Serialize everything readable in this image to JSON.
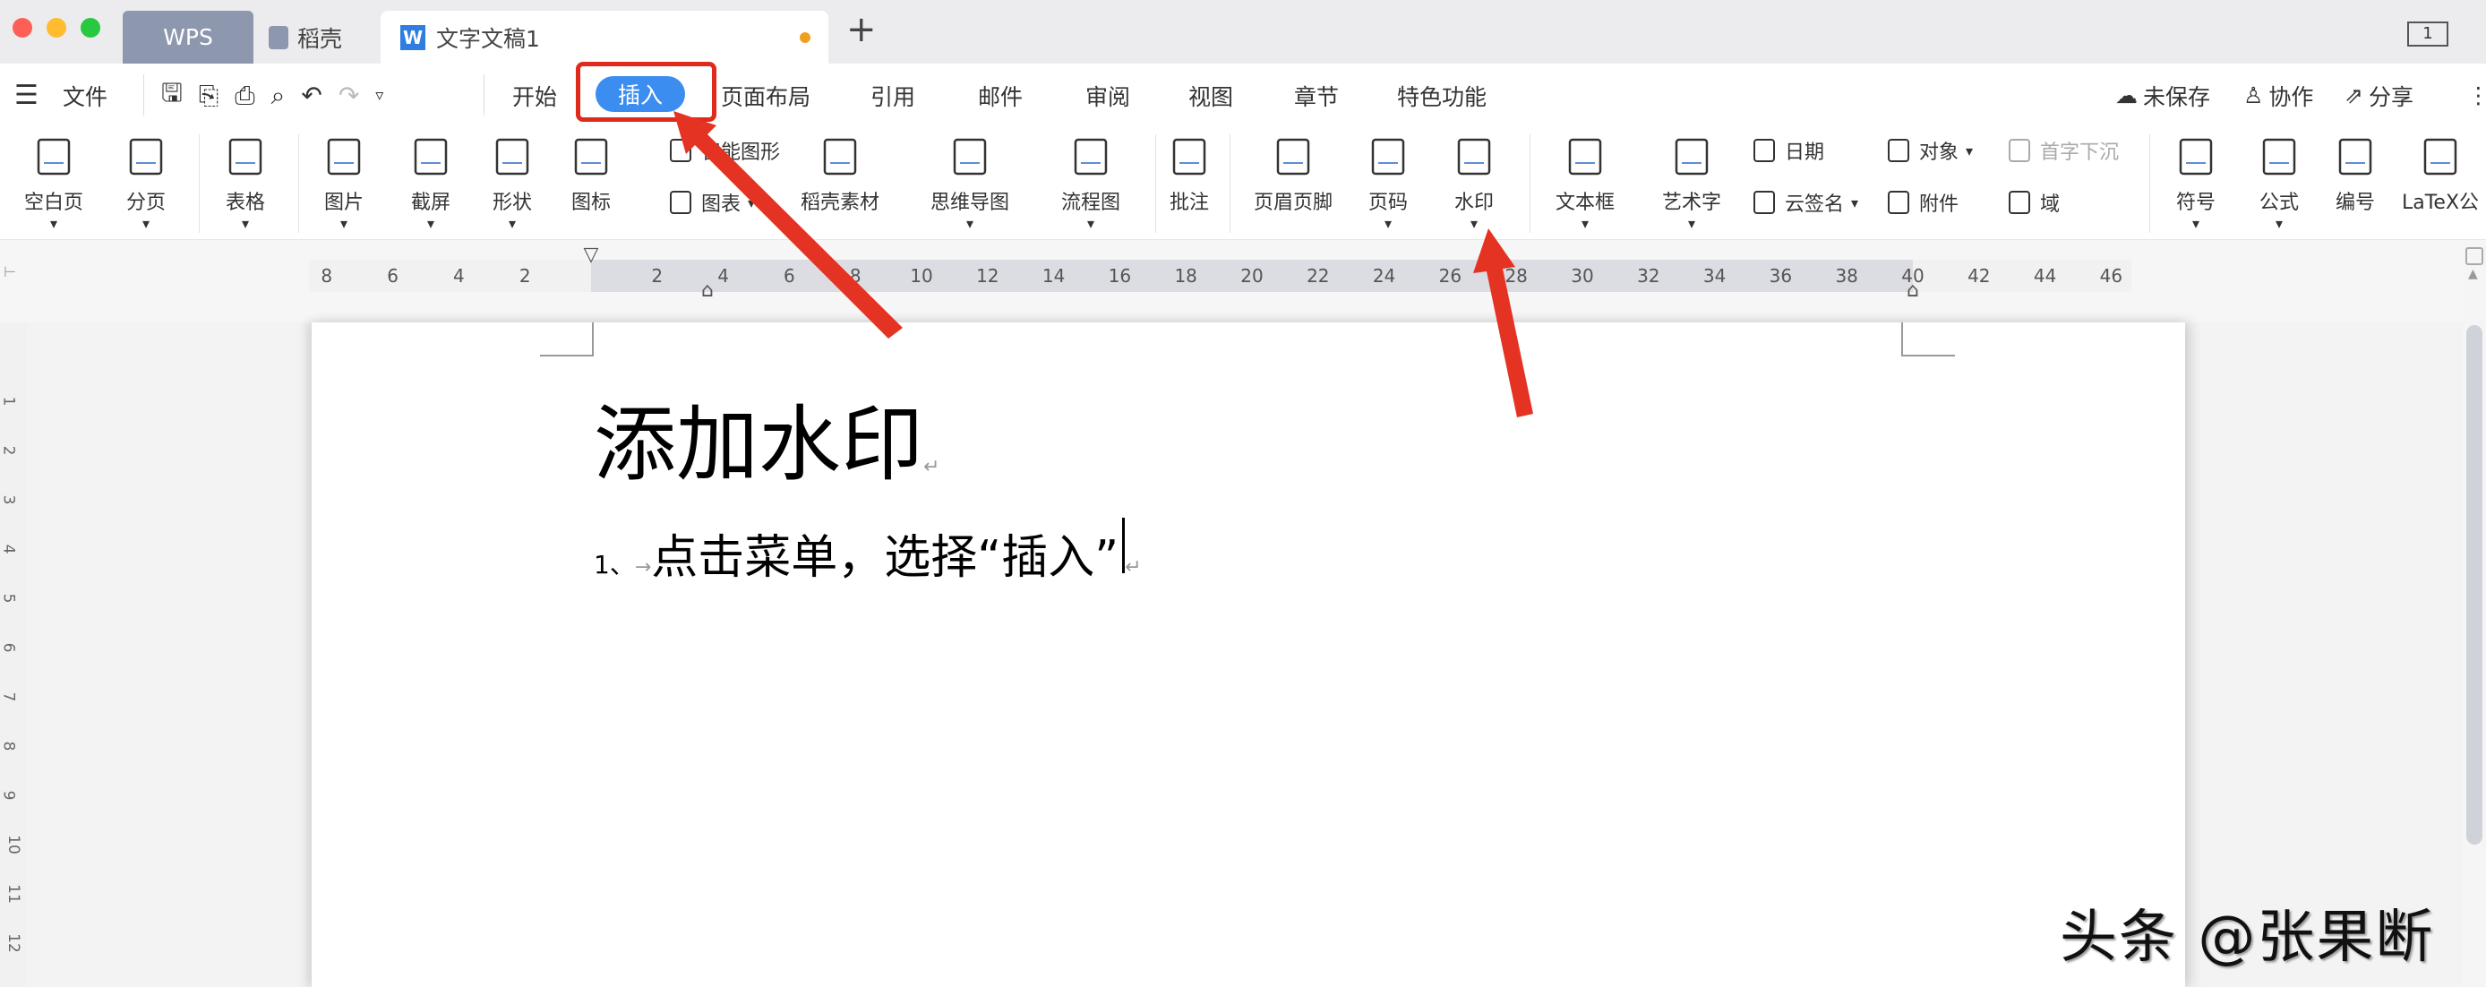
{
  "window": {
    "tabs": [
      {
        "label": "WPS"
      },
      {
        "label": "稻壳"
      },
      {
        "label": "文字文稿1"
      }
    ],
    "new_tab": "+",
    "page_indicator": "1"
  },
  "menu": {
    "file": "文件",
    "tabs": [
      "开始",
      "插入",
      "页面布局",
      "引用",
      "邮件",
      "审阅",
      "视图",
      "章节",
      "特色功能"
    ],
    "active_tab": "插入",
    "right": [
      "未保存",
      "协作",
      "分享"
    ]
  },
  "ribbon": {
    "large": [
      {
        "label": "空白页",
        "icon": "blank-page-icon",
        "dropdown": true
      },
      {
        "label": "分页",
        "icon": "page-break-icon",
        "dropdown": true
      },
      {
        "label": "表格",
        "icon": "table-icon",
        "dropdown": true
      },
      {
        "label": "图片",
        "icon": "picture-icon",
        "dropdown": true
      },
      {
        "label": "截屏",
        "icon": "screenshot-icon",
        "dropdown": true
      },
      {
        "label": "形状",
        "icon": "shape-icon",
        "dropdown": true
      },
      {
        "label": "图标",
        "icon": "icons-icon",
        "dropdown": false
      },
      {
        "label": "稻壳素材",
        "icon": "daoke-material-icon",
        "dropdown": false
      },
      {
        "label": "思维导图",
        "icon": "mindmap-icon",
        "dropdown": true
      },
      {
        "label": "流程图",
        "icon": "flowchart-icon",
        "dropdown": true
      },
      {
        "label": "批注",
        "icon": "comment-icon",
        "dropdown": false
      },
      {
        "label": "页眉页脚",
        "icon": "header-footer-icon",
        "dropdown": false
      },
      {
        "label": "页码",
        "icon": "page-number-icon",
        "dropdown": true
      },
      {
        "label": "水印",
        "icon": "watermark-icon",
        "dropdown": true
      },
      {
        "label": "文本框",
        "icon": "textbox-icon",
        "dropdown": true
      },
      {
        "label": "艺术字",
        "icon": "wordart-icon",
        "dropdown": true
      },
      {
        "label": "符号",
        "icon": "symbol-icon",
        "dropdown": true
      },
      {
        "label": "公式",
        "icon": "formula-icon",
        "dropdown": true
      },
      {
        "label": "编号",
        "icon": "numbering-icon",
        "dropdown": false
      },
      {
        "label": "LaTeX公",
        "icon": "latex-icon",
        "dropdown": false
      }
    ],
    "small": [
      {
        "label": "智能图形",
        "icon": "smart-art-icon",
        "dropdown": false
      },
      {
        "label": "图表",
        "icon": "chart-icon",
        "dropdown": true
      },
      {
        "label": "日期",
        "icon": "date-icon",
        "dropdown": false
      },
      {
        "label": "云签名",
        "icon": "cloud-sign-icon",
        "dropdown": true
      },
      {
        "label": "对象",
        "icon": "object-icon",
        "dropdown": true
      },
      {
        "label": "附件",
        "icon": "attachment-icon",
        "dropdown": false
      },
      {
        "label": "首字下沉",
        "icon": "drop-cap-icon",
        "dropdown": false
      },
      {
        "label": "域",
        "icon": "field-icon",
        "dropdown": false
      }
    ]
  },
  "ruler": {
    "left": [
      "8",
      "6",
      "4",
      "2"
    ],
    "right": [
      "2",
      "4",
      "6",
      "8",
      "10",
      "12",
      "14",
      "16",
      "18",
      "20",
      "22",
      "24",
      "26",
      "28",
      "30",
      "32",
      "34",
      "36",
      "38",
      "40",
      "42",
      "44",
      "46"
    ],
    "vertical": [
      "1",
      "2",
      "3",
      "4",
      "5",
      "6",
      "7",
      "8",
      "9",
      "10",
      "11",
      "12"
    ]
  },
  "document": {
    "title": "添加水印",
    "list_number": "1、",
    "line": "点击菜单，选择“插入”"
  },
  "watermark": "头条 @张果断",
  "colors": {
    "accent": "#3b8df0",
    "annotation": "#e02a1c"
  }
}
